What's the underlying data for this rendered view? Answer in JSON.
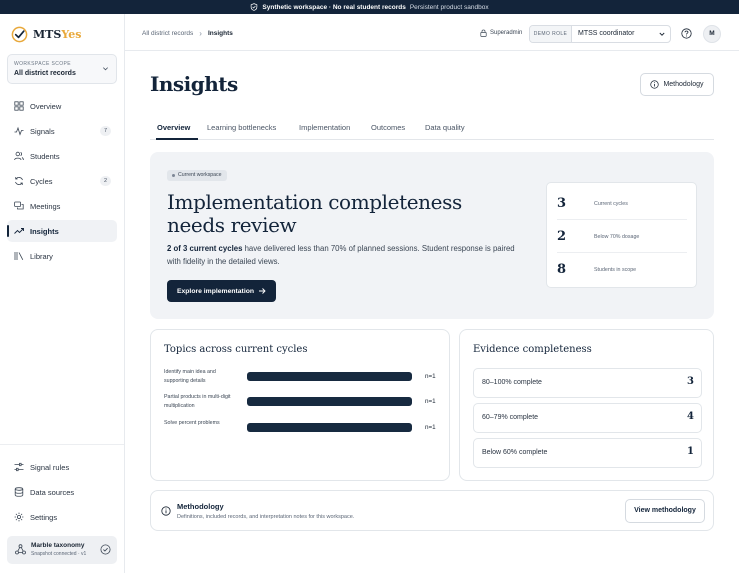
{
  "banner": {
    "strong": "Synthetic workspace · No real student records",
    "light": "Persistent product sandbox"
  },
  "brand": {
    "name_main": "MTS",
    "name_accent": "Yes"
  },
  "sidebar": {
    "scope_label": "WORKSPACE SCOPE",
    "scope_value": "All district records",
    "nav": [
      {
        "label": "Overview",
        "icon": "overview-icon"
      },
      {
        "label": "Signals",
        "count": "7",
        "icon": "signals-icon"
      },
      {
        "label": "Students",
        "icon": "students-icon"
      },
      {
        "label": "Cycles",
        "count": "2",
        "icon": "cycles-icon"
      },
      {
        "label": "Meetings",
        "icon": "meetings-icon"
      },
      {
        "label": "Insights",
        "icon": "insights-icon",
        "active": true
      },
      {
        "label": "Library",
        "icon": "library-icon"
      }
    ],
    "bottom_nav": [
      {
        "label": "Signal rules",
        "icon": "sliders-icon"
      },
      {
        "label": "Data sources",
        "icon": "database-icon"
      },
      {
        "label": "Settings",
        "icon": "gear-icon"
      }
    ],
    "taxonomy": {
      "title": "Marble taxonomy",
      "subtitle": "Snapshot connected · v1"
    }
  },
  "topbar": {
    "breadcrumb_root": "All district records",
    "breadcrumb_sep": "›",
    "breadcrumb_current": "Insights",
    "user_role_tag": "Superadmin",
    "demo_role_label": "DEMO ROLE",
    "demo_role_value": "MTSS coordinator",
    "avatar_initial": "M"
  },
  "page": {
    "title": "Insights",
    "methodology_button": "Methodology",
    "tabs": [
      "Overview",
      "Learning bottlenecks",
      "Implementation",
      "Outcomes",
      "Data quality"
    ],
    "active_tab": "Overview"
  },
  "hero": {
    "chip": "Current workspace",
    "headline": "Implementation completeness needs review",
    "body_bold": "2 of 3 current cycles",
    "body_rest": " have delivered less than 70% of planned sessions. Student response is paired with fidelity in the detailed views.",
    "cta": "Explore implementation",
    "stats": [
      {
        "value": "3",
        "label": "Current cycles"
      },
      {
        "value": "2",
        "label": "Below 70% dosage"
      },
      {
        "value": "8",
        "label": "Students in scope"
      }
    ]
  },
  "topics": {
    "title": "Topics across current cycles",
    "rows": [
      {
        "label": "Identify main idea and supporting details",
        "count": "n=1",
        "fill": 1.0
      },
      {
        "label": "Partial products in multi-digit multiplication",
        "count": "n=1",
        "fill": 1.0
      },
      {
        "label": "Solve percent problems",
        "count": "n=1",
        "fill": 1.0
      }
    ]
  },
  "evidence": {
    "title": "Evidence completeness",
    "rows": [
      {
        "label": "80–100% complete",
        "value": "3"
      },
      {
        "label": "60–79% complete",
        "value": "4"
      },
      {
        "label": "Below 60% complete",
        "value": "1"
      }
    ]
  },
  "methodology": {
    "title": "Methodology",
    "subtitle": "Definitions, included records, and interpretation notes for this workspace.",
    "button": "View methodology"
  },
  "colors": {
    "navy": "#13243a",
    "accent": "#e8a83a"
  }
}
